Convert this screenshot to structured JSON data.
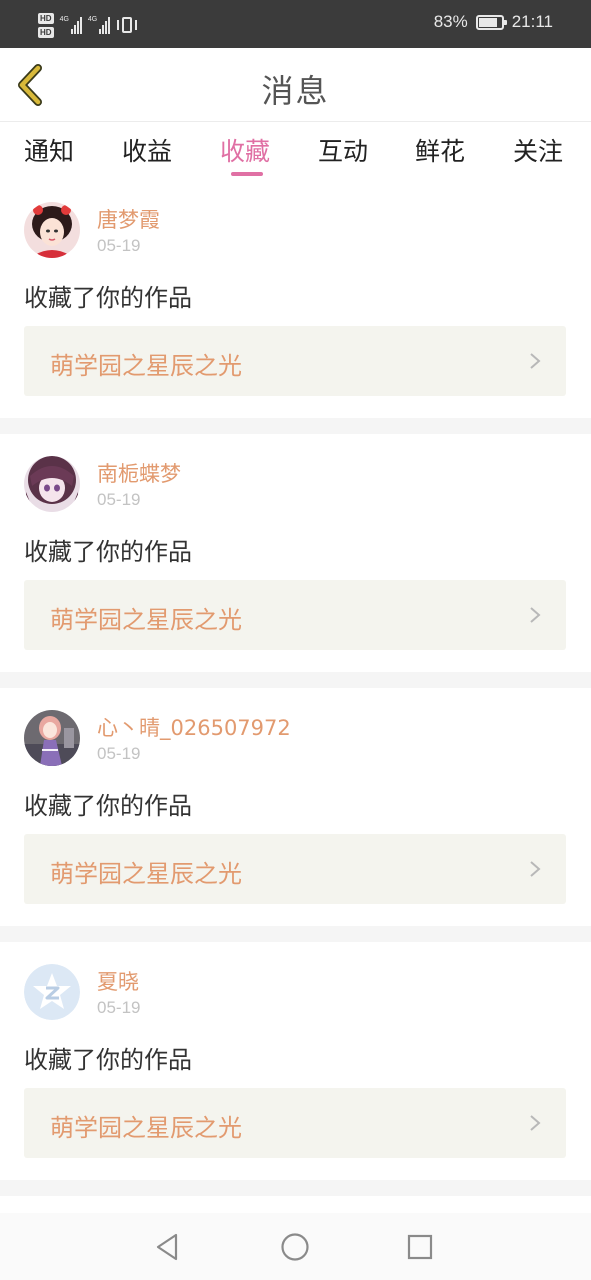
{
  "status_bar": {
    "hd_badge_1": "HD",
    "hd_badge_2": "HD",
    "network_1": "4G",
    "network_2": "4G",
    "battery_text": "83%",
    "battery_level": 0.83,
    "time": "21:11"
  },
  "header": {
    "title": "消息",
    "back_icon": "back-chevron-icon"
  },
  "tabs": [
    {
      "label": "通知",
      "active": false
    },
    {
      "label": "收益",
      "active": false
    },
    {
      "label": "收藏",
      "active": true
    },
    {
      "label": "互动",
      "active": false
    },
    {
      "label": "鲜花",
      "active": false
    },
    {
      "label": "关注",
      "active": false
    }
  ],
  "items": [
    {
      "username": "唐梦霞",
      "date": "05-19",
      "action": "收藏了你的作品",
      "work_title": "萌学园之星辰之光"
    },
    {
      "username": "南栀蝶梦",
      "date": "05-19",
      "action": "收藏了你的作品",
      "work_title": "萌学园之星辰之光"
    },
    {
      "username": "心丶晴_026507972",
      "date": "05-19",
      "action": "收藏了你的作品",
      "work_title": "萌学园之星辰之光"
    },
    {
      "username": "夏晓",
      "date": "05-19",
      "action": "收藏了你的作品",
      "work_title": "萌学园之星辰之光"
    }
  ],
  "colors": {
    "accent_pink": "#e070a4",
    "name_orange": "#e29a6f",
    "back_gold": "#d8b93a"
  },
  "nav_bar": {
    "back_icon": "triangle-back-icon",
    "home_icon": "circle-home-icon",
    "recents_icon": "square-recents-icon"
  }
}
